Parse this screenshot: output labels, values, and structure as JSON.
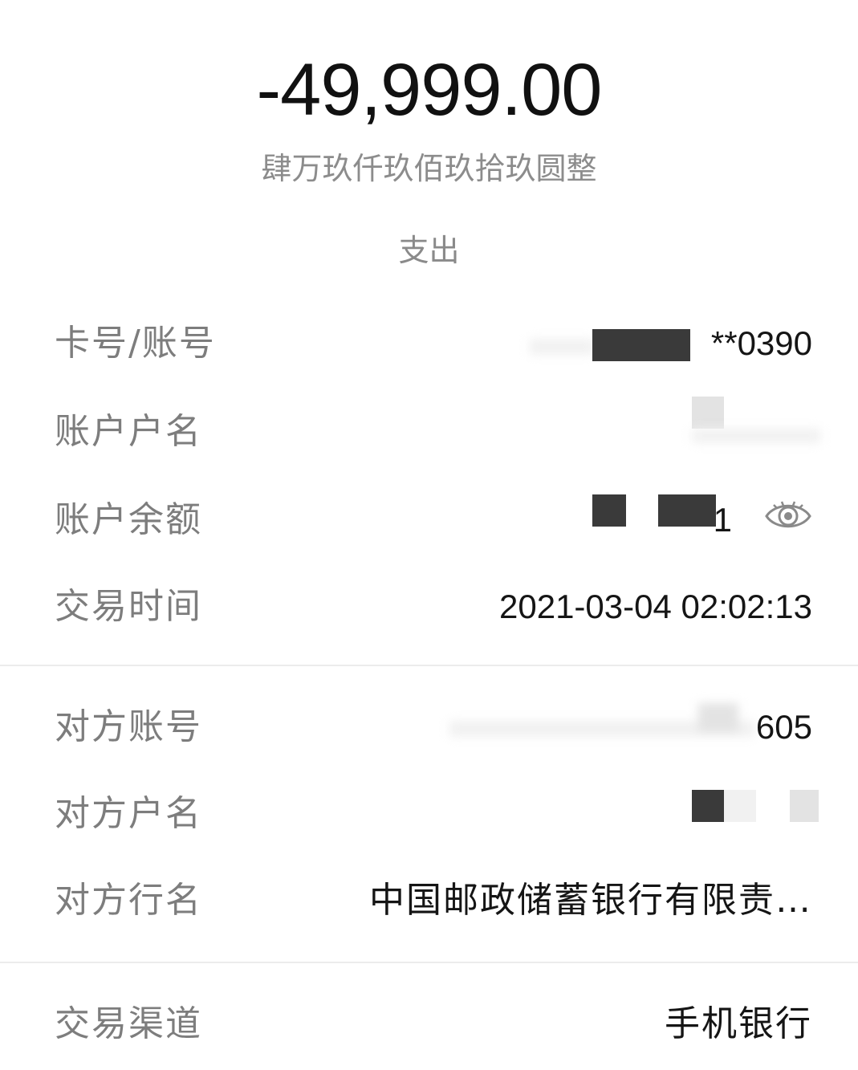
{
  "transaction": {
    "amount": "-49,999.00",
    "amount_words": "肆万玖仟玖佰玖拾玖圆整",
    "direction": "支出"
  },
  "fields": {
    "card_number": {
      "label": "卡号/账号",
      "value": "**0390"
    },
    "account_name": {
      "label": "账户户名",
      "value": ""
    },
    "balance": {
      "label": "账户余额",
      "value": "1"
    },
    "time": {
      "label": "交易时间",
      "value": "2021-03-04 02:02:13"
    },
    "counterparty_account": {
      "label": "对方账号",
      "value": "605"
    },
    "counterparty_name": {
      "label": "对方户名",
      "value": ""
    },
    "counterparty_bank": {
      "label": "对方行名",
      "value": "中国邮政储蓄银行有限责…"
    },
    "channel": {
      "label": "交易渠道",
      "value": "手机银行"
    }
  },
  "icons": {
    "balance_toggle": "eye-icon"
  },
  "colors": {
    "amount_text": "#111111",
    "label_text": "#7d7d7d",
    "secondary_text": "#8c8c8c",
    "divider": "#ececec"
  }
}
